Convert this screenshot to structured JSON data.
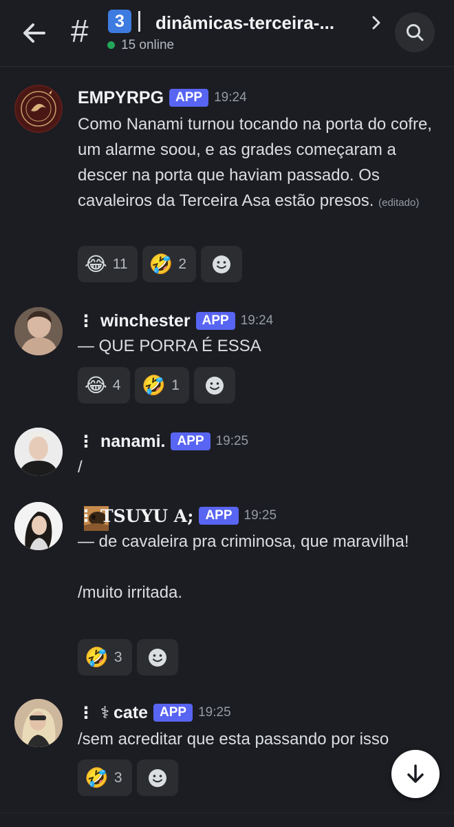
{
  "header": {
    "channel_emoji": "3",
    "channel_name": "dinâmicas-terceira-...",
    "online_text": "15 online"
  },
  "colors": {
    "background": "#1c1d22",
    "app_badge": "#5865f2",
    "online": "#23a55a"
  },
  "messages": [
    {
      "username": "EMPYRPG",
      "badge": "APP",
      "time": "19:24",
      "text": "Como Nanami turnou tocando na porta do cofre, um alarme soou, e as grades começaram a descer na porta que haviam passado. Os cavaleiros da Terceira Asa estão presos.",
      "edited": "(editado)",
      "reactions": [
        {
          "emoji": "😂",
          "count": "11"
        },
        {
          "emoji": "🤣",
          "count": "2"
        }
      ]
    },
    {
      "prefix": "⋮",
      "username": "winchester",
      "badge": "APP",
      "time": "19:24",
      "text": "— QUE PORRA É ESSA",
      "reactions": [
        {
          "emoji": "😂",
          "count": "4"
        },
        {
          "emoji": "🤣",
          "count": "1"
        }
      ]
    },
    {
      "prefix": "⋮",
      "username": "nanami.",
      "badge": "APP",
      "time": "19:25",
      "text": "/"
    },
    {
      "prefix": "⋮",
      "username": "TSUYU A;",
      "badge": "APP",
      "time": "19:25",
      "text": "— de cavaleira pra criminosa, que maravilha!\n\n/muito irritada.",
      "reactions": [
        {
          "emoji": "🤣",
          "count": "3"
        }
      ]
    },
    {
      "prefix": "⋮",
      "symbol": "⚕",
      "username": "cate",
      "badge": "APP",
      "time": "19:25",
      "text": "/sem acreditar que esta passando por isso",
      "reactions": [
        {
          "emoji": "🤣",
          "count": "3"
        }
      ]
    }
  ]
}
